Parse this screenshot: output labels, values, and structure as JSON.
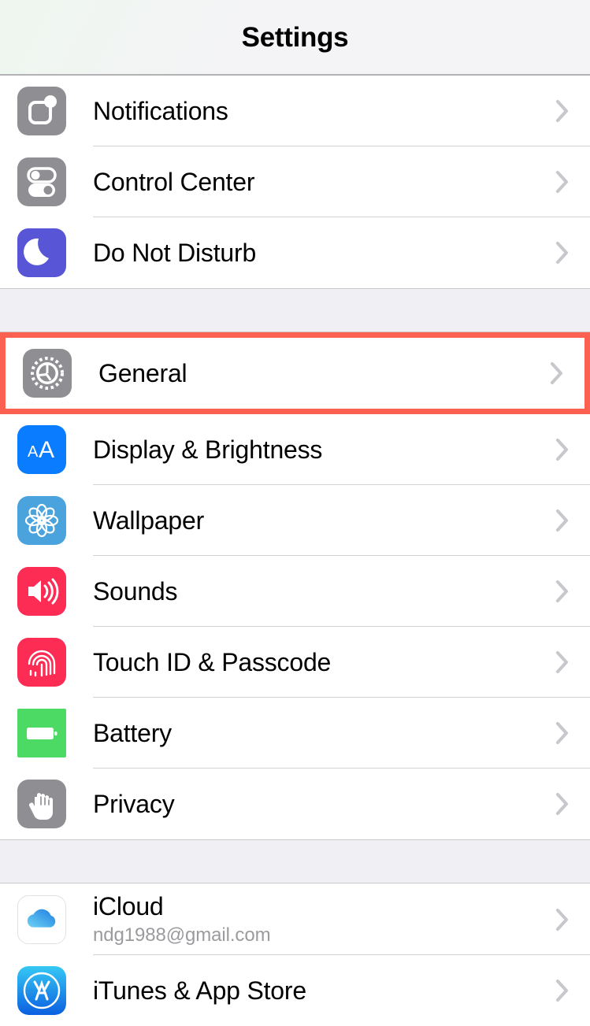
{
  "header": {
    "title": "Settings"
  },
  "colors": {
    "highlight": "#fb6050",
    "group_background": "#efeff4",
    "separator": "#d2d2d4",
    "chevron": "#c7c7cc",
    "label": "#000000",
    "sublabel": "#9b9b9f"
  },
  "groups": [
    {
      "name": "notifications-group",
      "rows": [
        {
          "label": "Notifications",
          "icon": "notifications-icon",
          "icon_color": "#8e8e93",
          "chevron": "chevron-right-icon",
          "highlighted": false
        },
        {
          "label": "Control Center",
          "icon": "control-center-icon",
          "icon_color": "#8e8e93",
          "chevron": "chevron-right-icon",
          "highlighted": false
        },
        {
          "label": "Do Not Disturb",
          "icon": "moon-icon",
          "icon_color": "#5856d6",
          "chevron": "chevron-right-icon",
          "highlighted": false
        }
      ]
    },
    {
      "name": "general-group",
      "rows": [
        {
          "label": "General",
          "icon": "gear-icon",
          "icon_color": "#8e8e93",
          "chevron": "chevron-right-icon",
          "highlighted": true
        },
        {
          "label": "Display & Brightness",
          "icon": "aa-text-icon",
          "icon_color": "#0a7cff",
          "chevron": "chevron-right-icon",
          "highlighted": false
        },
        {
          "label": "Wallpaper",
          "icon": "flower-icon",
          "icon_color": "#4aa3dd",
          "chevron": "chevron-right-icon",
          "highlighted": false
        },
        {
          "label": "Sounds",
          "icon": "speaker-icon",
          "icon_color": "#fc2c55",
          "chevron": "chevron-right-icon",
          "highlighted": false
        },
        {
          "label": "Touch ID & Passcode",
          "icon": "fingerprint-icon",
          "icon_color": "#fc2c55",
          "chevron": "chevron-right-icon",
          "highlighted": false
        },
        {
          "label": "Battery",
          "icon": "battery-icon",
          "icon_color": "#4cd964",
          "chevron": "chevron-right-icon",
          "highlighted": false
        },
        {
          "label": "Privacy",
          "icon": "hand-icon",
          "icon_color": "#8e8e93",
          "chevron": "chevron-right-icon",
          "highlighted": false
        }
      ]
    },
    {
      "name": "accounts-group",
      "rows": [
        {
          "label": "iCloud",
          "sublabel": "ndg1988@gmail.com",
          "icon": "icloud-icon",
          "icon_color": "#ffffff",
          "chevron": "chevron-right-icon",
          "highlighted": false
        },
        {
          "label": "iTunes & App Store",
          "icon": "app-store-icon",
          "icon_color": "#1f9bf5",
          "chevron": "chevron-right-icon",
          "highlighted": false
        }
      ]
    }
  ]
}
